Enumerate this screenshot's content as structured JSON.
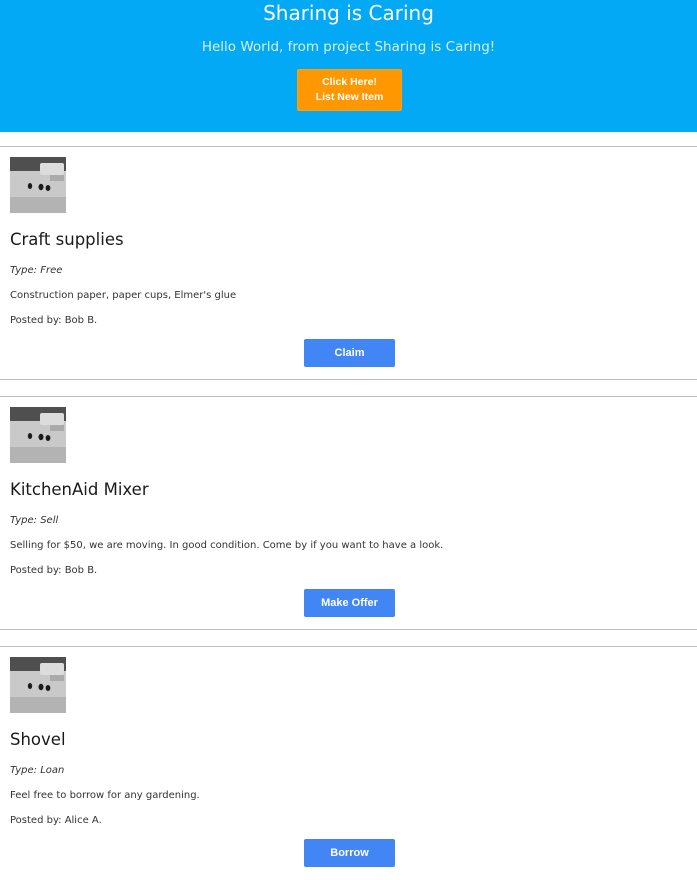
{
  "header": {
    "title": "Sharing is Caring",
    "subtitle": "Hello World, from project Sharing is Caring!",
    "list_button": {
      "line1": "Click Here!",
      "line2": "List New Item"
    }
  },
  "colors": {
    "header_bg": "#03a9f4",
    "list_button_bg": "#ff9800",
    "action_button_bg": "#4285f4"
  },
  "items": [
    {
      "title": "Craft supplies",
      "type": "Type: Free",
      "description": "Construction paper, paper cups, Elmer's glue",
      "posted_by": "Posted by: Bob B.",
      "action": "Claim",
      "image_icon": "item-photo"
    },
    {
      "title": "KitchenAid Mixer",
      "type": "Type: Sell",
      "description": "Selling for $50, we are moving. In good condition. Come by if you want to have a look.",
      "posted_by": "Posted by: Bob B.",
      "action": "Make Offer",
      "image_icon": "item-photo"
    },
    {
      "title": "Shovel",
      "type": "Type: Loan",
      "description": "Feel free to borrow for any gardening.",
      "posted_by": "Posted by: Alice A.",
      "action": "Borrow",
      "image_icon": "item-photo"
    }
  ]
}
